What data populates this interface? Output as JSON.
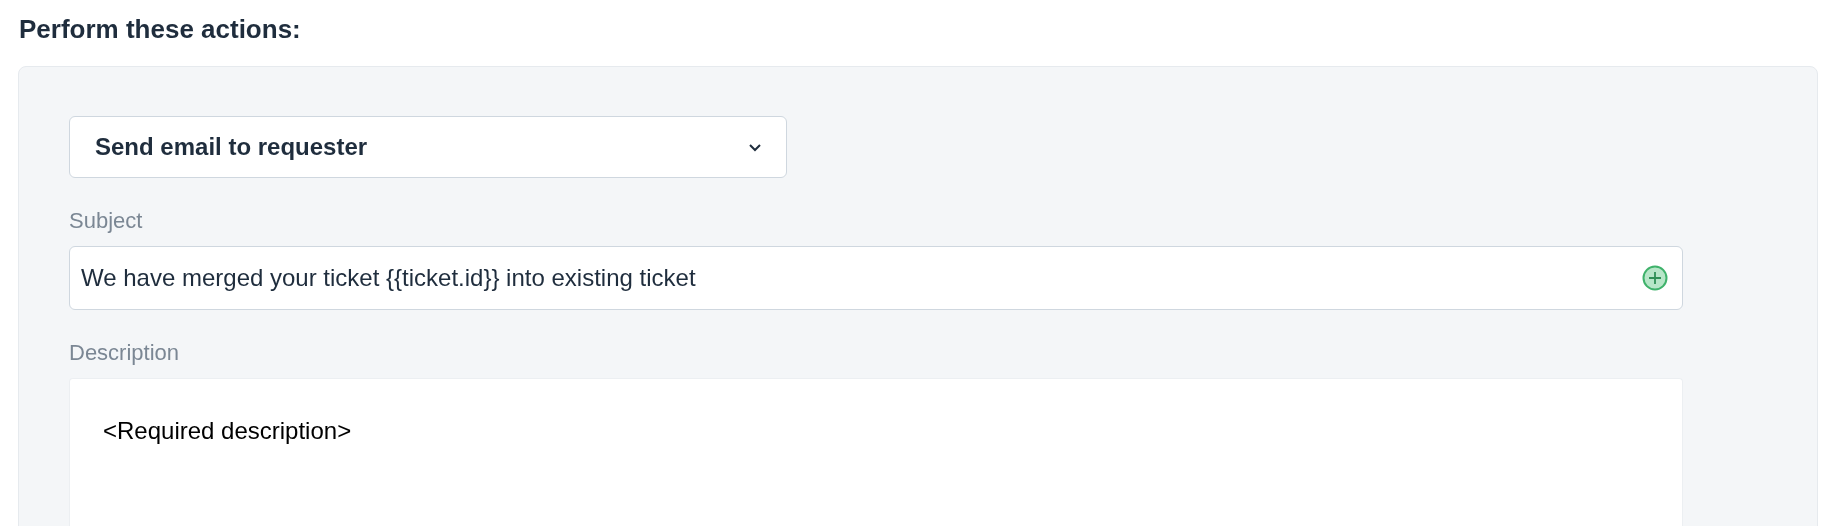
{
  "heading": "Perform these actions:",
  "action_select": {
    "value": "Send email to requester"
  },
  "subject": {
    "label": "Subject",
    "value": "We have merged your ticket {{ticket.id}} into existing ticket"
  },
  "description": {
    "label": "Description",
    "value": "<Required description>"
  }
}
